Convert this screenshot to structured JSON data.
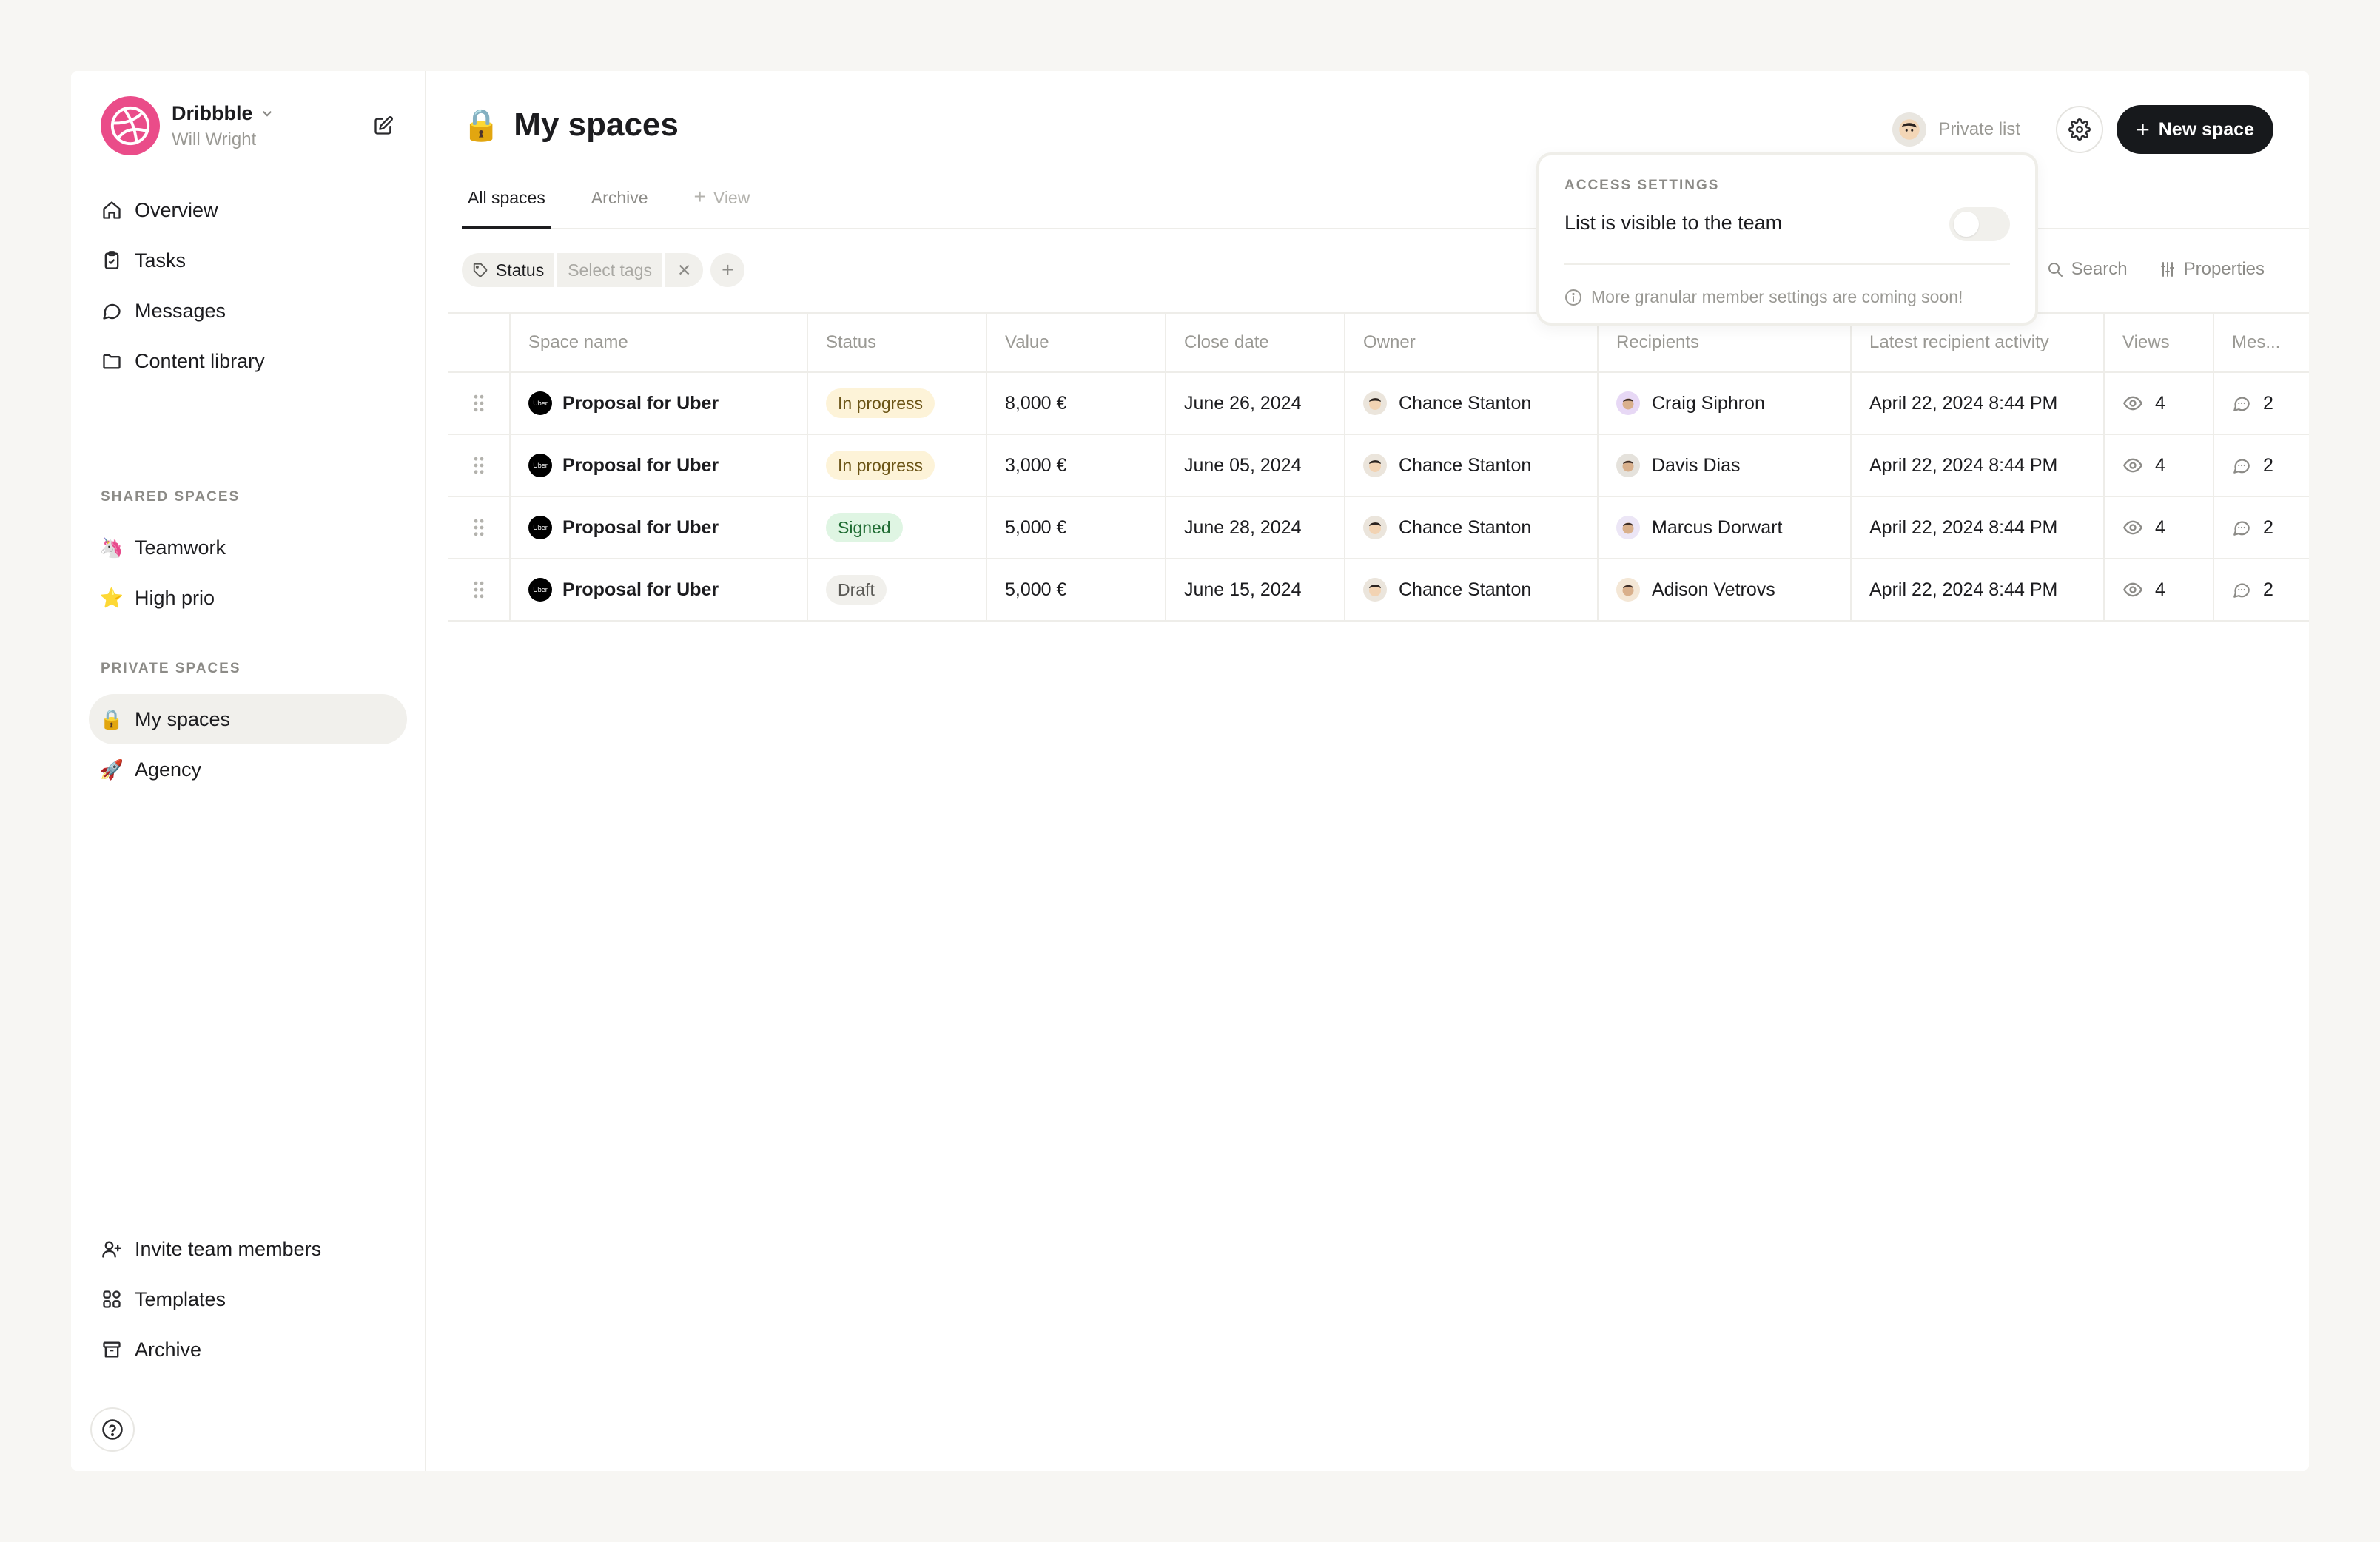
{
  "workspace": {
    "name": "Dribbble",
    "user": "Will Wright"
  },
  "nav": {
    "main": [
      {
        "label": "Overview",
        "icon": "home-icon"
      },
      {
        "label": "Tasks",
        "icon": "clipboard-icon"
      },
      {
        "label": "Messages",
        "icon": "chat-bubble-icon"
      },
      {
        "label": "Content library",
        "icon": "folder-icon"
      }
    ],
    "shared_label": "SHARED SPACES",
    "shared": [
      {
        "label": "Teamwork",
        "icon": "🦄"
      },
      {
        "label": "High prio",
        "icon": "⭐"
      }
    ],
    "private_label": "PRIVATE SPACES",
    "private": [
      {
        "label": "My spaces",
        "icon": "🔒"
      },
      {
        "label": "Agency",
        "icon": "🚀"
      }
    ],
    "bottom": [
      {
        "label": "Invite team members",
        "icon": "user-plus-icon"
      },
      {
        "label": "Templates",
        "icon": "grid-icon"
      },
      {
        "label": "Archive",
        "icon": "archive-box-icon"
      }
    ]
  },
  "header": {
    "title": "My spaces",
    "title_icon": "🔒",
    "private_list": "Private list",
    "new_space": "New space"
  },
  "tabs": [
    {
      "label": "All spaces"
    },
    {
      "label": "Archive"
    },
    {
      "label": "View"
    }
  ],
  "filters": {
    "status": "Status",
    "tags_placeholder": "Select tags"
  },
  "toolbar": {
    "search": "Search",
    "properties": "Properties"
  },
  "popover": {
    "label": "ACCESS SETTINGS",
    "text": "List is visible to the team",
    "note": "More granular member settings are coming soon!",
    "toggle_on": false
  },
  "table": {
    "columns": [
      "Space name",
      "Status",
      "Value",
      "Close date",
      "Owner",
      "Recipients",
      "Latest recipient activity",
      "Views",
      "Mes..."
    ],
    "rows": [
      {
        "name": "Proposal for Uber",
        "status": "In progress",
        "value": "8,000 €",
        "close": "June 26, 2024",
        "owner": "Chance Stanton",
        "recipient": "Craig Siphron",
        "activity": "April 22, 2024 8:44 PM",
        "views": "4",
        "messages": "2"
      },
      {
        "name": "Proposal for Uber",
        "status": "In progress",
        "value": "3,000 €",
        "close": "June 05, 2024",
        "owner": "Chance Stanton",
        "recipient": "Davis Dias",
        "activity": "April 22, 2024 8:44 PM",
        "views": "4",
        "messages": "2"
      },
      {
        "name": "Proposal for Uber",
        "status": "Signed",
        "value": "5,000 €",
        "close": "June 28, 2024",
        "owner": "Chance Stanton",
        "recipient": "Marcus Dorwart",
        "activity": "April 22, 2024 8:44 PM",
        "views": "4",
        "messages": "2"
      },
      {
        "name": "Proposal for Uber",
        "status": "Draft",
        "value": "5,000 €",
        "close": "June 15, 2024",
        "owner": "Chance Stanton",
        "recipient": "Adison Vetrovs",
        "activity": "April 22, 2024 8:44 PM",
        "views": "4",
        "messages": "2"
      }
    ]
  },
  "logo_text": "Uber",
  "colors": {
    "in_progress_bg": "#fdf3d8",
    "in_progress_fg": "#6b5416",
    "signed_bg": "#dff5e3",
    "signed_fg": "#1f6b32",
    "draft_bg": "#f1f0ec",
    "draft_fg": "#5a5955"
  }
}
